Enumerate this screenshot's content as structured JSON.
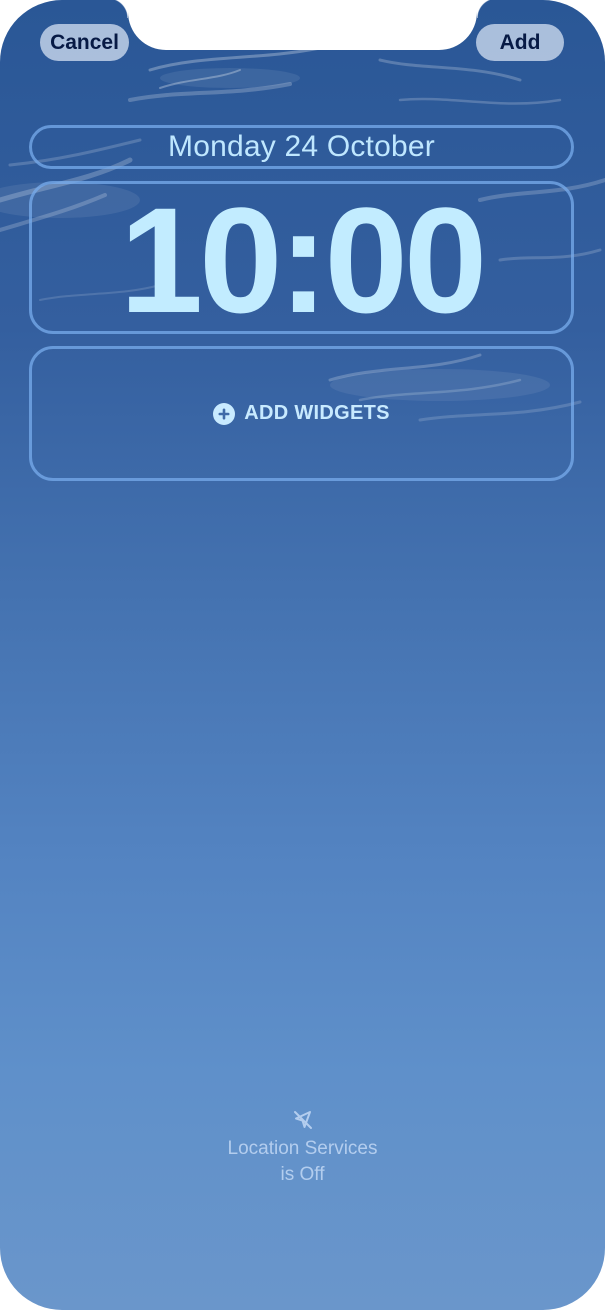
{
  "header": {
    "cancel_label": "Cancel",
    "add_label": "Add"
  },
  "lock_screen": {
    "date": "Monday 24 October",
    "time": "10:00",
    "add_widgets_label": "ADD WIDGETS"
  },
  "footer": {
    "location_line1": "Location Services",
    "location_line2": "is Off",
    "icon": "location-off-icon"
  },
  "colors": {
    "sky_top": "#2a5796",
    "sky_bottom": "#6a96cb",
    "frame_border": "#78acec",
    "clock_text": "#c2ecff",
    "button_text": "#071a45"
  }
}
